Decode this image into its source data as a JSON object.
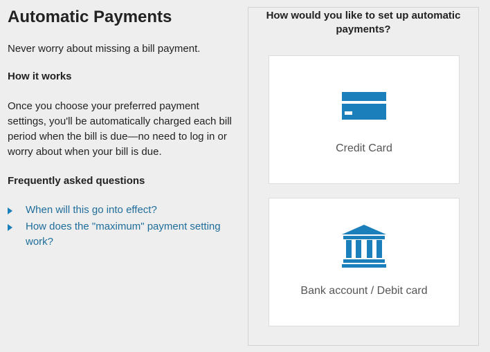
{
  "page": {
    "title": "Automatic Payments",
    "tagline": "Never worry about missing a bill payment."
  },
  "how_it_works": {
    "heading": "How it works",
    "body": "Once you choose your preferred payment settings, you'll be automatically charged each bill period when the bill is due—no need to log in or worry about when your bill is due."
  },
  "faq": {
    "heading": "Frequently asked questions",
    "items": [
      "When will this go into effect?",
      "How does the \"maximum\" payment setting work?"
    ]
  },
  "setup": {
    "question": "How would you like to set up automatic payments?",
    "options": [
      {
        "label": "Credit Card",
        "icon": "credit-card-icon"
      },
      {
        "label": "Bank account / Debit card",
        "icon": "bank-icon"
      }
    ]
  },
  "colors": {
    "background": "#eeeeee",
    "link": "#1f6d9b",
    "icon": "#1a7fba",
    "card": "#ffffff"
  }
}
